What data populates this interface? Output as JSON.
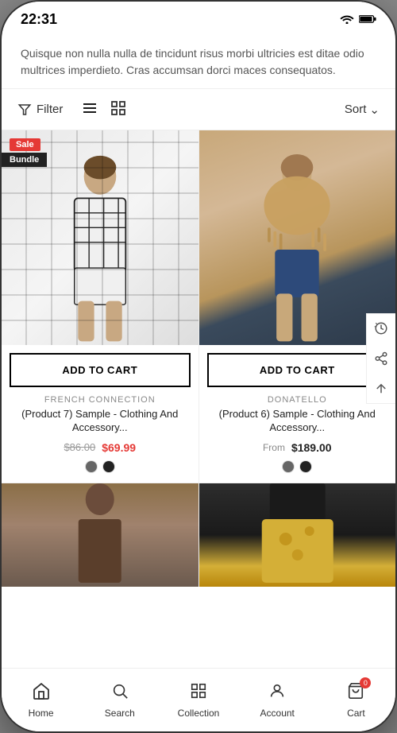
{
  "status": {
    "time": "22:31"
  },
  "description": "Quisque non nulla nulla de tincidunt risus morbi ultricies est ditae odio multrices imperdieto. Cras accumsan dorci maces consequatos.",
  "filter": {
    "label": "Filter",
    "sort_label": "Sort"
  },
  "products": [
    {
      "id": 1,
      "brand": "FRENCH CONNECTION",
      "name": "(Product 7) Sample - Clothing And Accessory...",
      "original_price": "$86.00",
      "sale_price": "$69.99",
      "has_sale": true,
      "has_bundle": true,
      "from_label": "",
      "colors": [
        "dark",
        "black"
      ],
      "add_to_cart": "ADD TO CART"
    },
    {
      "id": 2,
      "brand": "DONATELLO",
      "name": "(Product 6) Sample - Clothing And Accessory...",
      "original_price": "",
      "sale_price": "$189.00",
      "has_sale": false,
      "has_bundle": false,
      "from_label": "From",
      "colors": [
        "dark",
        "black"
      ],
      "add_to_cart": "ADD TO CART"
    },
    {
      "id": 3,
      "brand": "",
      "name": "",
      "original_price": "",
      "sale_price": "",
      "has_sale": false,
      "has_bundle": false,
      "from_label": "",
      "colors": [],
      "add_to_cart": ""
    },
    {
      "id": 4,
      "brand": "",
      "name": "",
      "original_price": "",
      "sale_price": "",
      "has_sale": false,
      "has_bundle": false,
      "from_label": "",
      "colors": [],
      "add_to_cart": ""
    }
  ],
  "nav": {
    "home": "Home",
    "search": "Search",
    "collection": "Collection",
    "account": "Account",
    "cart": "Cart",
    "cart_count": "0"
  },
  "badges": {
    "sale": "Sale",
    "bundle": "Bundle"
  }
}
